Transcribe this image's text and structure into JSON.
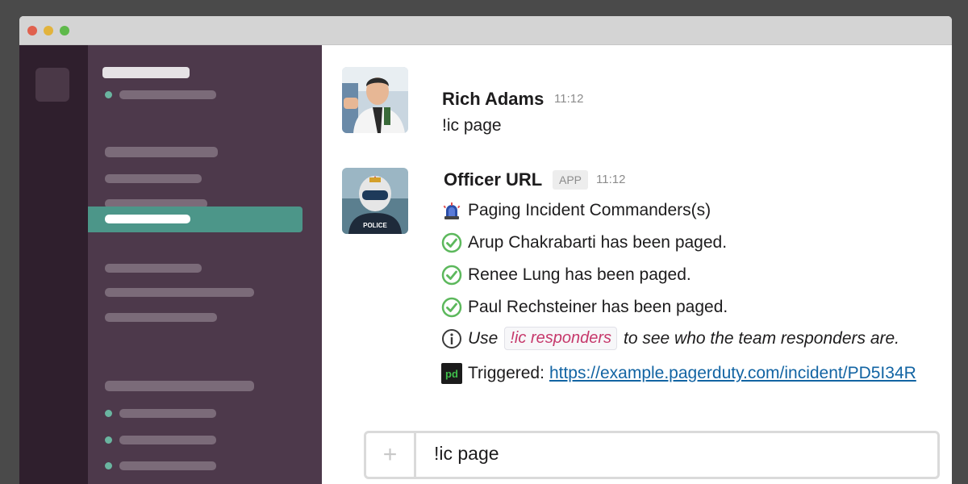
{
  "messages": [
    {
      "author": "Rich Adams",
      "time": "11:12",
      "text": "!ic page"
    },
    {
      "author": "Officer URL",
      "badge": "APP",
      "time": "11:12",
      "lines": {
        "paging": "Paging Incident Commanders(s)",
        "paged1": "Arup Chakrabarti has been paged.",
        "paged2": "Renee Lung has been paged.",
        "paged3": "Paul Rechsteiner has been paged.",
        "info_pre": "Use",
        "info_code": "!ic responders",
        "info_post": "to see who the team responders are.",
        "triggered_label": "Triggered:",
        "triggered_link": "https://example.pagerduty.com/incident/PD5I34R"
      },
      "avatar_badge": "POLICE"
    }
  ],
  "composer": {
    "plus": "+",
    "value": "!ic page"
  },
  "colors": {
    "sidebar": "#4d394b",
    "team_rail": "#2f1f2d",
    "active": "#4c9689",
    "presence": "#6ab5a0",
    "check": "#5cb85c",
    "code": "#c6386b",
    "link": "#1264a3"
  },
  "icons": [
    "siren-icon",
    "check-circle-icon",
    "info-icon",
    "pagerduty-icon",
    "plus-icon"
  ]
}
